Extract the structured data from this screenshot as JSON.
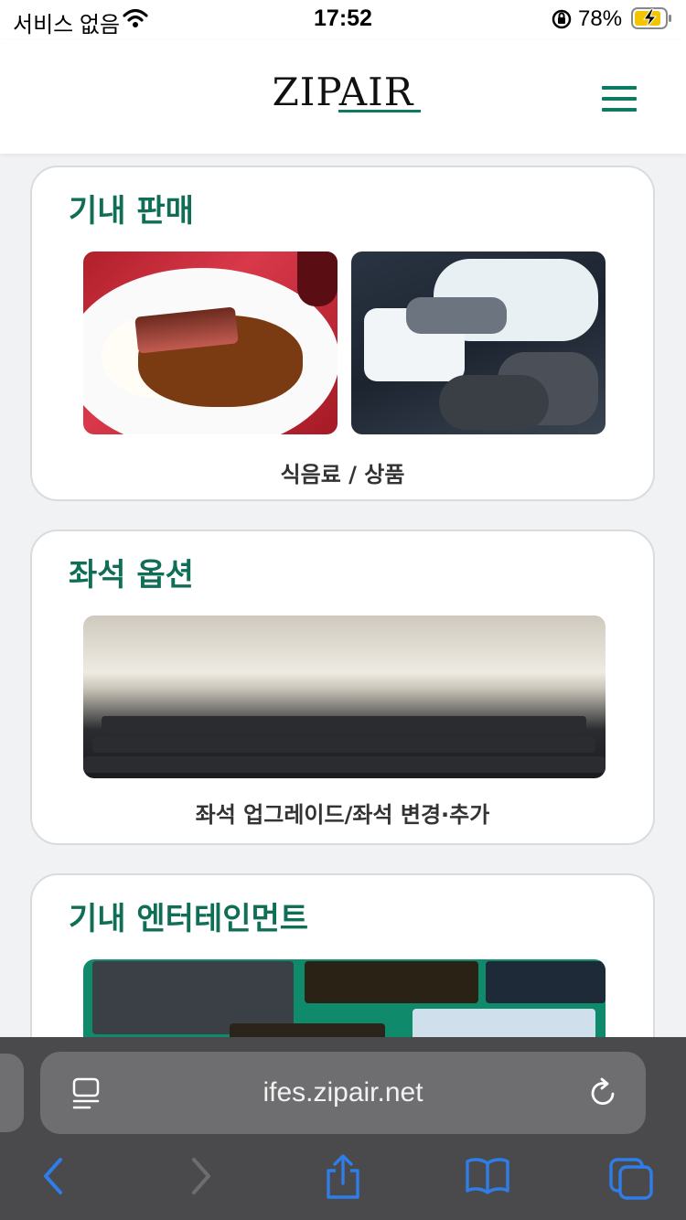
{
  "status_bar": {
    "carrier": "서비스 없음",
    "time": "17:52",
    "battery_percent": "78%"
  },
  "header": {
    "logo": "ZIPAIR"
  },
  "sections": [
    {
      "title": "기내 판매",
      "caption": "식음료 / 상품"
    },
    {
      "title": "좌석 옵션",
      "caption": "좌석 업그레이드/좌석 변경·추가"
    },
    {
      "title": "기내 엔터테인먼트"
    }
  ],
  "browser": {
    "url": "ifes.zipair.net"
  },
  "colors": {
    "accent": "#0f7a62",
    "section_title": "#0f6e55"
  }
}
